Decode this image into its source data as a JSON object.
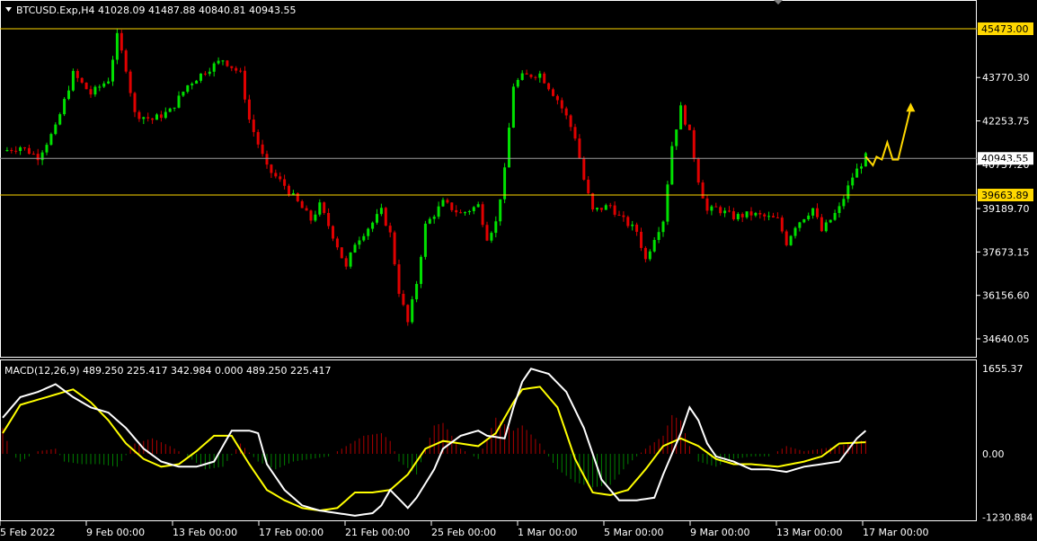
{
  "header": {
    "symbol_line": "BTCUSD.Exp,H4  41028.09 41487.88 40840.81 40943.55"
  },
  "macd_header": "MACD(12,26,9) 489.250 225.417 342.984 0.000 489.250 225.417",
  "colors": {
    "background": "#000000",
    "bull": "#00e000",
    "bear": "#e00000",
    "level": "#ffd800",
    "grid": "#ffffff",
    "signal": "#ffff00",
    "macd_line": "#ffffff"
  },
  "chart_data": [
    {
      "type": "candlestick",
      "title": "BTCUSD.Exp,H4",
      "ohlc_now": {
        "open": 41028.09,
        "high": 41487.88,
        "low": 40840.81,
        "close": 40943.55
      },
      "y_ticks": [
        "43770.30",
        "42253.75",
        "40737.20",
        "39189.70",
        "37673.15",
        "36156.60",
        "34640.05"
      ],
      "ylim": [
        34200,
        46150
      ],
      "levels": [
        {
          "price": 45473.0,
          "label": "45473.00"
        },
        {
          "price": 39663.89,
          "label": "39663.89"
        }
      ],
      "current_price": {
        "price": 40943.55,
        "label": "40943.55"
      },
      "close_path": [
        [
          0,
          41200
        ],
        [
          4,
          41350
        ],
        [
          8,
          41000
        ],
        [
          12,
          42000
        ],
        [
          16,
          43900
        ],
        [
          20,
          43200
        ],
        [
          24,
          43700
        ],
        [
          26,
          45200
        ],
        [
          28,
          44100
        ],
        [
          30,
          42500
        ],
        [
          34,
          42300
        ],
        [
          38,
          42600
        ],
        [
          42,
          43500
        ],
        [
          46,
          44000
        ],
        [
          50,
          44400
        ],
        [
          54,
          43900
        ],
        [
          56,
          42300
        ],
        [
          60,
          40600
        ],
        [
          64,
          40000
        ],
        [
          66,
          39600
        ],
        [
          70,
          38800
        ],
        [
          72,
          39300
        ],
        [
          76,
          37900
        ],
        [
          78,
          37100
        ],
        [
          80,
          38000
        ],
        [
          84,
          38700
        ],
        [
          86,
          39100
        ],
        [
          88,
          38300
        ],
        [
          90,
          36300
        ],
        [
          92,
          35200
        ],
        [
          94,
          36600
        ],
        [
          96,
          38600
        ],
        [
          100,
          39400
        ],
        [
          104,
          39000
        ],
        [
          108,
          39300
        ],
        [
          110,
          38200
        ],
        [
          112,
          38700
        ],
        [
          114,
          40500
        ],
        [
          116,
          43500
        ],
        [
          118,
          43800
        ],
        [
          122,
          43900
        ],
        [
          126,
          43000
        ],
        [
          128,
          42400
        ],
        [
          130,
          41700
        ],
        [
          132,
          40200
        ],
        [
          134,
          39100
        ],
        [
          138,
          39300
        ],
        [
          140,
          38900
        ],
        [
          144,
          38400
        ],
        [
          146,
          37400
        ],
        [
          148,
          38200
        ],
        [
          150,
          38800
        ],
        [
          152,
          41400
        ],
        [
          154,
          42700
        ],
        [
          156,
          41800
        ],
        [
          158,
          40200
        ],
        [
          160,
          39100
        ],
        [
          162,
          39200
        ],
        [
          166,
          38900
        ],
        [
          170,
          39000
        ],
        [
          176,
          38800
        ],
        [
          178,
          38000
        ],
        [
          180,
          38600
        ],
        [
          184,
          39200
        ],
        [
          186,
          38400
        ],
        [
          190,
          39200
        ],
        [
          193,
          40300
        ],
        [
          196,
          41000
        ]
      ],
      "forecast_arrows": [
        [
          [
            40700,
            41000
          ],
          [
            41400,
            40900
          ]
        ],
        [
          [
            40900,
            41500
          ],
          [
            41500,
            40900
          ]
        ],
        [
          [
            40900,
            42700
          ]
        ]
      ],
      "x_ticks": [
        "5 Feb 2022",
        "9 Feb 00:00",
        "13 Feb 00:00",
        "17 Feb 00:00",
        "21 Feb 00:00",
        "25 Feb 00:00",
        "1 Mar 00:00",
        "5 Mar 00:00",
        "9 Mar 00:00",
        "13 Mar 00:00",
        "17 Mar 00:00"
      ]
    },
    {
      "type": "macd",
      "params": "MACD(12,26,9)",
      "values": {
        "histogram": 489.25,
        "signal": 225.417,
        "main": 342.984,
        "zero": 0.0
      },
      "y_ticks": [
        "1655.37",
        "0.00",
        "-1230.884"
      ],
      "ylim": [
        -1230.884,
        1655.37
      ],
      "main_path": [
        [
          0,
          700
        ],
        [
          4,
          1100
        ],
        [
          8,
          1200
        ],
        [
          12,
          1350
        ],
        [
          16,
          1100
        ],
        [
          20,
          900
        ],
        [
          24,
          800
        ],
        [
          28,
          500
        ],
        [
          32,
          100
        ],
        [
          36,
          -150
        ],
        [
          40,
          -250
        ],
        [
          44,
          -250
        ],
        [
          48,
          -150
        ],
        [
          52,
          450
        ],
        [
          56,
          450
        ],
        [
          58,
          400
        ],
        [
          60,
          -200
        ],
        [
          64,
          -700
        ],
        [
          68,
          -1000
        ],
        [
          72,
          -1100
        ],
        [
          76,
          -1150
        ],
        [
          80,
          -1200
        ],
        [
          84,
          -1150
        ],
        [
          86,
          -1000
        ],
        [
          88,
          -700
        ],
        [
          92,
          -1050
        ],
        [
          94,
          -850
        ],
        [
          98,
          -300
        ],
        [
          100,
          100
        ],
        [
          104,
          350
        ],
        [
          108,
          450
        ],
        [
          110,
          350
        ],
        [
          114,
          300
        ],
        [
          116,
          900
        ],
        [
          118,
          1400
        ],
        [
          120,
          1650
        ],
        [
          124,
          1550
        ],
        [
          128,
          1200
        ],
        [
          132,
          500
        ],
        [
          136,
          -500
        ],
        [
          140,
          -900
        ],
        [
          144,
          -900
        ],
        [
          148,
          -850
        ],
        [
          150,
          -400
        ],
        [
          154,
          400
        ],
        [
          156,
          900
        ],
        [
          158,
          650
        ],
        [
          160,
          200
        ],
        [
          162,
          -50
        ],
        [
          166,
          -150
        ],
        [
          170,
          -300
        ],
        [
          174,
          -300
        ],
        [
          178,
          -350
        ],
        [
          182,
          -250
        ],
        [
          186,
          -200
        ],
        [
          190,
          -150
        ],
        [
          194,
          300
        ],
        [
          196,
          450
        ]
      ],
      "signal_path": [
        [
          0,
          400
        ],
        [
          4,
          950
        ],
        [
          8,
          1050
        ],
        [
          12,
          1150
        ],
        [
          16,
          1250
        ],
        [
          20,
          1000
        ],
        [
          24,
          650
        ],
        [
          28,
          200
        ],
        [
          32,
          -100
        ],
        [
          36,
          -250
        ],
        [
          40,
          -200
        ],
        [
          44,
          50
        ],
        [
          48,
          350
        ],
        [
          52,
          350
        ],
        [
          56,
          -200
        ],
        [
          60,
          -700
        ],
        [
          64,
          -900
        ],
        [
          68,
          -1050
        ],
        [
          72,
          -1100
        ],
        [
          76,
          -1050
        ],
        [
          80,
          -750
        ],
        [
          84,
          -750
        ],
        [
          88,
          -700
        ],
        [
          92,
          -400
        ],
        [
          96,
          100
        ],
        [
          100,
          250
        ],
        [
          104,
          200
        ],
        [
          108,
          150
        ],
        [
          112,
          400
        ],
        [
          116,
          1000
        ],
        [
          118,
          1250
        ],
        [
          122,
          1300
        ],
        [
          126,
          900
        ],
        [
          130,
          -100
        ],
        [
          134,
          -750
        ],
        [
          138,
          -800
        ],
        [
          142,
          -700
        ],
        [
          146,
          -300
        ],
        [
          150,
          150
        ],
        [
          154,
          300
        ],
        [
          158,
          150
        ],
        [
          162,
          -100
        ],
        [
          166,
          -200
        ],
        [
          170,
          -200
        ],
        [
          176,
          -250
        ],
        [
          182,
          -150
        ],
        [
          186,
          -50
        ],
        [
          190,
          200
        ],
        [
          196,
          225
        ]
      ],
      "histogram_path": [
        [
          0,
          500
        ],
        [
          2,
          0
        ],
        [
          4,
          -150
        ],
        [
          8,
          50
        ],
        [
          12,
          100
        ],
        [
          14,
          -150
        ],
        [
          18,
          -200
        ],
        [
          22,
          -200
        ],
        [
          26,
          -250
        ],
        [
          30,
          200
        ],
        [
          34,
          300
        ],
        [
          38,
          150
        ],
        [
          42,
          -50
        ],
        [
          46,
          -300
        ],
        [
          50,
          -250
        ],
        [
          54,
          200
        ],
        [
          58,
          -150
        ],
        [
          62,
          -300
        ],
        [
          66,
          -150
        ],
        [
          70,
          -100
        ],
        [
          74,
          -50
        ],
        [
          78,
          150
        ],
        [
          82,
          350
        ],
        [
          86,
          400
        ],
        [
          88,
          250
        ],
        [
          90,
          -150
        ],
        [
          94,
          -400
        ],
        [
          98,
          550
        ],
        [
          100,
          600
        ],
        [
          104,
          100
        ],
        [
          108,
          -100
        ],
        [
          112,
          700
        ],
        [
          116,
          450
        ],
        [
          118,
          550
        ],
        [
          122,
          200
        ],
        [
          126,
          -300
        ],
        [
          130,
          -550
        ],
        [
          134,
          -650
        ],
        [
          138,
          -600
        ],
        [
          142,
          -200
        ],
        [
          146,
          100
        ],
        [
          150,
          350
        ],
        [
          152,
          750
        ],
        [
          154,
          650
        ],
        [
          156,
          150
        ],
        [
          158,
          -150
        ],
        [
          162,
          -250
        ],
        [
          166,
          -100
        ],
        [
          170,
          -50
        ],
        [
          174,
          -50
        ],
        [
          178,
          150
        ],
        [
          182,
          50
        ],
        [
          186,
          100
        ],
        [
          190,
          150
        ],
        [
          194,
          250
        ],
        [
          196,
          260
        ]
      ]
    }
  ]
}
